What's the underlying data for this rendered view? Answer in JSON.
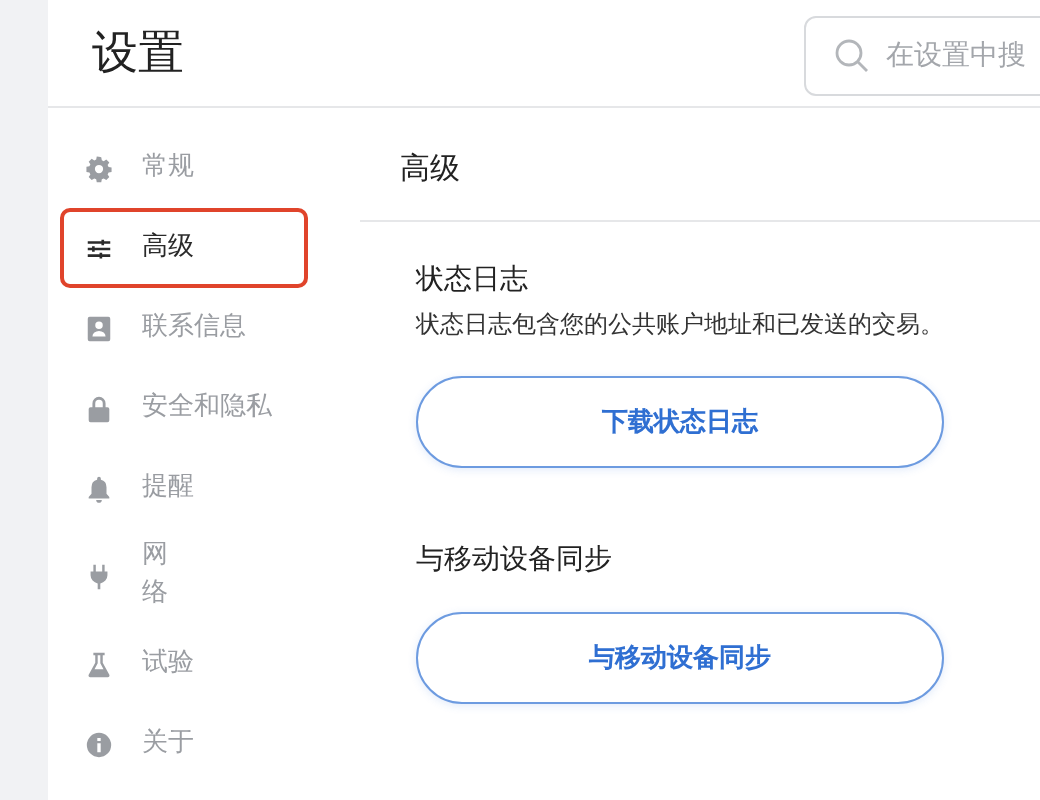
{
  "header": {
    "title": "设置",
    "search": {
      "placeholder": "在设置中搜"
    }
  },
  "sidebar": {
    "items": [
      {
        "kind": "gear",
        "label": "常规",
        "selected": false,
        "annotated": false
      },
      {
        "kind": "sliders",
        "label": "高级",
        "selected": true,
        "annotated": true
      },
      {
        "kind": "contact",
        "label": "联系信息",
        "selected": false,
        "annotated": false
      },
      {
        "kind": "lock",
        "label": "安全和隐私",
        "selected": false,
        "annotated": false
      },
      {
        "kind": "bell",
        "label": "提醒",
        "selected": false,
        "annotated": false
      },
      {
        "kind": "plug",
        "label": "网络",
        "selected": false,
        "annotated": false
      },
      {
        "kind": "flask",
        "label": "试验",
        "selected": false,
        "annotated": false
      },
      {
        "kind": "info",
        "label": "关于",
        "selected": false,
        "annotated": false
      }
    ]
  },
  "content": {
    "title": "高级",
    "sections": [
      {
        "title": "状态日志",
        "description": "状态日志包含您的公共账户地址和已发送的交易。",
        "button": "下载状态日志"
      },
      {
        "title": "与移动设备同步",
        "button": "与移动设备同步"
      }
    ]
  }
}
